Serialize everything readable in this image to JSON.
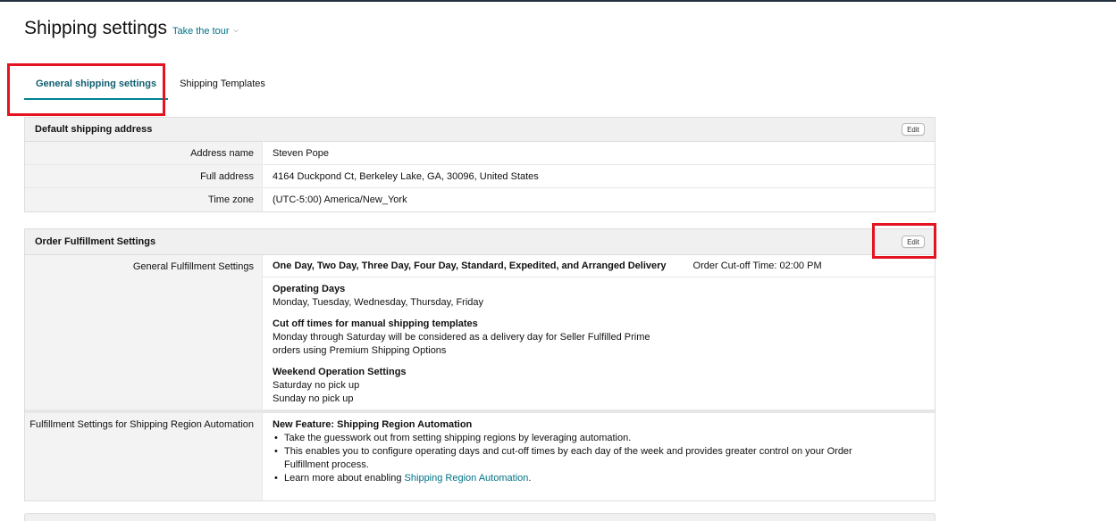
{
  "page": {
    "title": "Shipping settings",
    "tour_link": "Take the tour"
  },
  "tabs": [
    {
      "label": "General shipping settings",
      "active": true
    },
    {
      "label": "Shipping Templates",
      "active": false
    }
  ],
  "default_address": {
    "title": "Default shipping address",
    "edit_label": "Edit",
    "rows": [
      {
        "label": "Address name",
        "value": "Steven Pope"
      },
      {
        "label": "Full address",
        "value": "4164 Duckpond Ct, Berkeley Lake, GA, 30096, United States"
      },
      {
        "label": "Time zone",
        "value": "(UTC-5:00) America/New_York"
      }
    ]
  },
  "order_fulfillment": {
    "title": "Order Fulfillment Settings",
    "edit_label": "Edit",
    "general": {
      "label": "General Fulfillment Settings",
      "speeds": "One Day, Two Day, Three Day, Four Day, Standard, Expedited, and Arranged Delivery",
      "cutoff": "Order Cut-off Time: 02:00 PM",
      "blocks": [
        {
          "title": "Operating Days",
          "lines": [
            "Monday, Tuesday, Wednesday, Thursday, Friday"
          ]
        },
        {
          "title": "Cut off times for manual shipping templates",
          "lines": [
            "Monday through Saturday will be considered as a delivery day for Seller Fulfilled Prime",
            "orders using Premium Shipping Options"
          ]
        },
        {
          "title": "Weekend Operation Settings",
          "lines": [
            "Saturday no pick up",
            "Sunday no pick up"
          ]
        }
      ]
    },
    "region": {
      "label": "Fulfillment Settings for Shipping Region Automation",
      "feature_title": "New Feature: Shipping Region Automation",
      "bullets": [
        "Take the guesswork out from setting shipping regions by leveraging automation.",
        "This enables you to configure operating days and cut-off times by each day of the week and provides greater control on your Order Fulfillment process."
      ],
      "learn_prefix": "Learn more about enabling ",
      "learn_link": "Shipping Region Automation",
      "learn_suffix": "."
    }
  },
  "colors": {
    "accent": "#008296",
    "link": "#007185",
    "highlight": "#e3141f",
    "header_bg": "#f0f0f0"
  }
}
